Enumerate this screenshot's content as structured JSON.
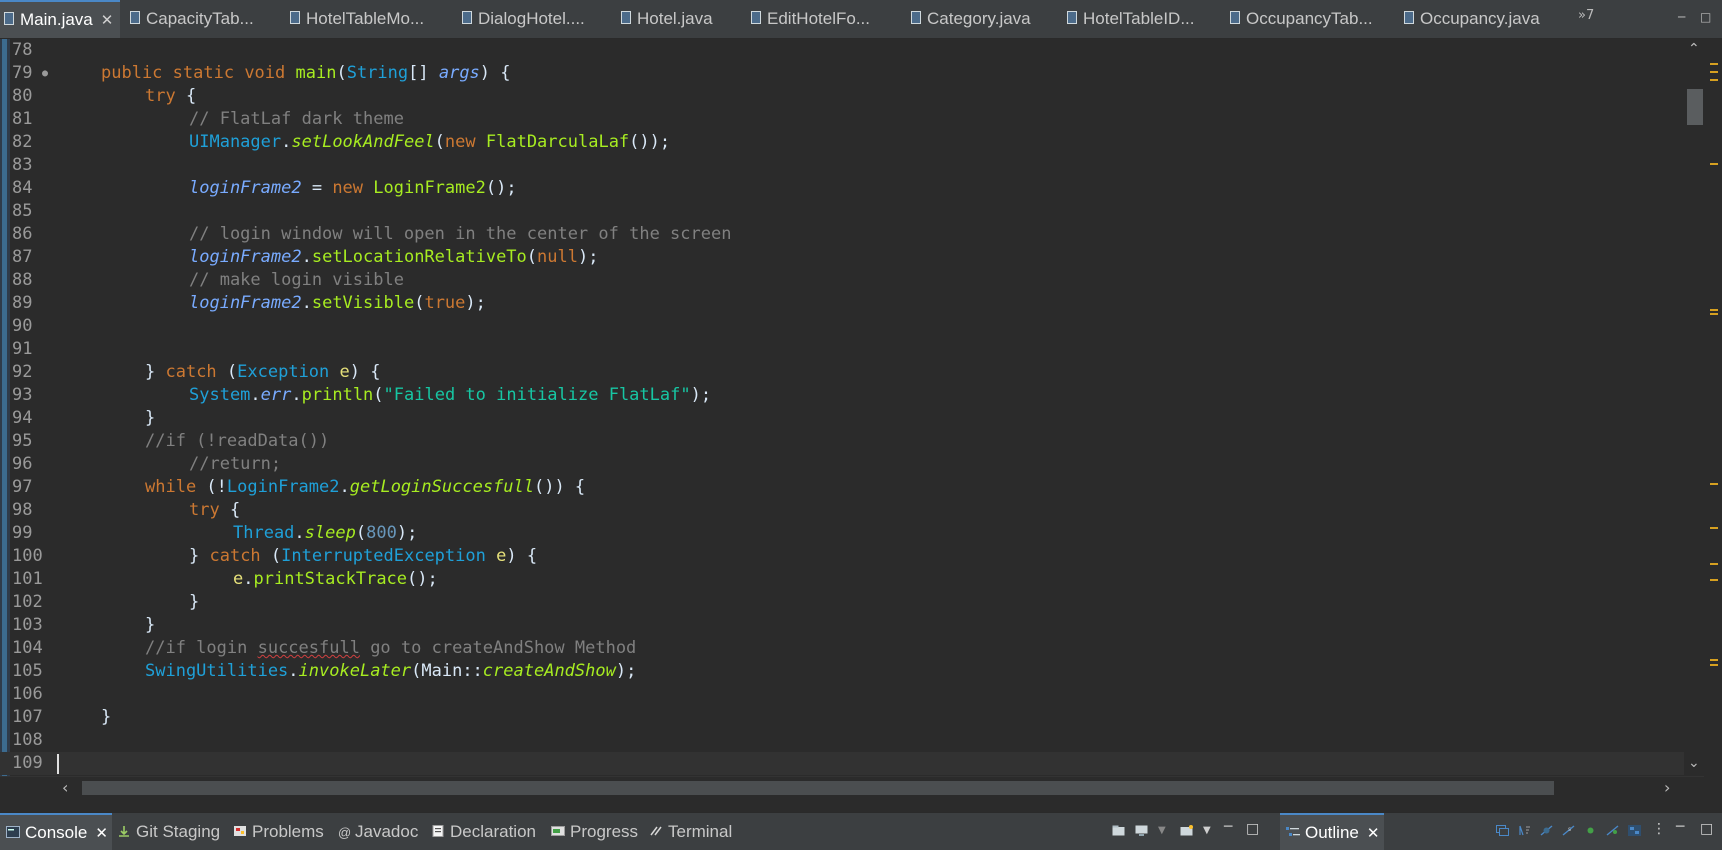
{
  "editor_tabs": [
    {
      "label": "Main.java",
      "active": true
    },
    {
      "label": "CapacityTab..."
    },
    {
      "label": "HotelTableMo..."
    },
    {
      "label": "DialogHotel...."
    },
    {
      "label": "Hotel.java"
    },
    {
      "label": "EditHotelFo..."
    },
    {
      "label": "Category.java"
    },
    {
      "label": "HotelTableID..."
    },
    {
      "label": "OccupancyTab..."
    },
    {
      "label": "Occupancy.java"
    }
  ],
  "overflow_count": "»7",
  "close_glyph": "✕",
  "code": {
    "line_numbers": [
      "78",
      "79",
      "80",
      "81",
      "82",
      "83",
      "84",
      "85",
      "86",
      "87",
      "88",
      "89",
      "90",
      "91",
      "92",
      "93",
      "94",
      "95",
      "96",
      "97",
      "98",
      "99",
      "100",
      "101",
      "102",
      "103",
      "104",
      "105",
      "106",
      "107",
      "108",
      "109"
    ],
    "lines": [
      [],
      [
        [
          "kw",
          "public "
        ],
        [
          "kw",
          "static "
        ],
        [
          "kw",
          "void "
        ],
        [
          "fn",
          "main"
        ],
        [
          "pl",
          "("
        ],
        [
          "ty",
          "String"
        ],
        [
          "pl",
          "[] "
        ],
        [
          "var",
          "args"
        ],
        [
          "pl",
          ") {"
        ]
      ],
      [
        [
          "kw",
          "try"
        ],
        [
          "pl",
          " {"
        ]
      ],
      [
        [
          "cm",
          "// FlatLaf dark theme"
        ]
      ],
      [
        [
          "ty",
          "UIManager"
        ],
        [
          "pl",
          "."
        ],
        [
          "fi",
          "setLookAndFeel"
        ],
        [
          "pl",
          "("
        ],
        [
          "kw",
          "new "
        ],
        [
          "fn",
          "FlatDarculaLaf"
        ],
        [
          "pl",
          "());"
        ]
      ],
      [],
      [
        [
          "var",
          "loginFrame2"
        ],
        [
          "pl",
          " = "
        ],
        [
          "kw",
          "new "
        ],
        [
          "fn",
          "LoginFrame2"
        ],
        [
          "pl",
          "();"
        ]
      ],
      [],
      [
        [
          "cm",
          "// login window will open in the center of the screen"
        ]
      ],
      [
        [
          "var",
          "loginFrame2"
        ],
        [
          "pl",
          "."
        ],
        [
          "fn",
          "setLocationRelativeTo"
        ],
        [
          "pl",
          "("
        ],
        [
          "kw",
          "null"
        ],
        [
          "pl",
          ");"
        ]
      ],
      [
        [
          "cm",
          "// make login visible"
        ]
      ],
      [
        [
          "var",
          "loginFrame2"
        ],
        [
          "pl",
          "."
        ],
        [
          "fn",
          "setVisible"
        ],
        [
          "pl",
          "("
        ],
        [
          "kw",
          "true"
        ],
        [
          "pl",
          ");"
        ]
      ],
      [],
      [],
      [
        [
          "pl",
          "} "
        ],
        [
          "kw",
          "catch "
        ],
        [
          "pl",
          "("
        ],
        [
          "ty",
          "Exception "
        ],
        [
          "par",
          "e"
        ],
        [
          "pl",
          ") {"
        ]
      ],
      [
        [
          "ty",
          "System"
        ],
        [
          "pl",
          "."
        ],
        [
          "var",
          "err"
        ],
        [
          "pl",
          "."
        ],
        [
          "fn",
          "println"
        ],
        [
          "pl",
          "("
        ],
        [
          "str",
          "\"Failed to initialize FlatLaf\""
        ],
        [
          "pl",
          ");"
        ]
      ],
      [
        [
          "pl",
          "}"
        ]
      ],
      [
        [
          "cm",
          "//if (!readData())"
        ]
      ],
      [
        [
          "cm",
          "//return;"
        ]
      ],
      [
        [
          "kw",
          "while "
        ],
        [
          "pl",
          "(!"
        ],
        [
          "ty",
          "LoginFrame2"
        ],
        [
          "pl",
          "."
        ],
        [
          "fi",
          "getLoginSuccesfull"
        ],
        [
          "pl",
          "()) {"
        ]
      ],
      [
        [
          "kw",
          "try"
        ],
        [
          "pl",
          " {"
        ]
      ],
      [
        [
          "ty",
          "Thread"
        ],
        [
          "pl",
          "."
        ],
        [
          "fi",
          "sleep"
        ],
        [
          "pl",
          "("
        ],
        [
          "num",
          "800"
        ],
        [
          "pl",
          ");"
        ]
      ],
      [
        [
          "pl",
          "} "
        ],
        [
          "kw",
          "catch "
        ],
        [
          "pl",
          "("
        ],
        [
          "ty",
          "InterruptedException "
        ],
        [
          "par",
          "e"
        ],
        [
          "pl",
          ") {"
        ]
      ],
      [
        [
          "par",
          "e"
        ],
        [
          "pl",
          "."
        ],
        [
          "fn",
          "printStackTrace"
        ],
        [
          "pl",
          "();"
        ]
      ],
      [
        [
          "pl",
          "}"
        ]
      ],
      [
        [
          "pl",
          "}"
        ]
      ],
      [
        [
          "cm",
          "//if login "
        ],
        [
          "cmsq",
          "succesfull"
        ],
        [
          "cm",
          " go to createAndShow Method"
        ]
      ],
      [
        [
          "ty",
          "SwingUtilities"
        ],
        [
          "pl",
          "."
        ],
        [
          "fi",
          "invokeLater"
        ],
        [
          "pl",
          "(Main::"
        ],
        [
          "fi",
          "createAndShow"
        ],
        [
          "pl",
          ");"
        ]
      ],
      [],
      [
        [
          "pl",
          "}"
        ]
      ],
      [],
      []
    ]
  },
  "bottom_tabs": [
    {
      "label": "Console",
      "active": true,
      "icon": "console-icon"
    },
    {
      "label": "Git Staging",
      "icon": "git-staging-icon"
    },
    {
      "label": "Problems",
      "icon": "problems-icon"
    },
    {
      "label": "Javadoc",
      "icon": "javadoc-icon"
    },
    {
      "label": "Declaration",
      "icon": "declaration-icon"
    },
    {
      "label": "Progress",
      "icon": "progress-icon"
    },
    {
      "label": "Terminal",
      "icon": "terminal-icon"
    }
  ],
  "outline_tab": {
    "label": "Outline",
    "icon": "outline-icon"
  },
  "colors": {
    "editor_bg": "#2b2b2b",
    "keyword": "#cc7832",
    "type": "#1fa0d8",
    "method": "#a7ec21",
    "comment": "#808080",
    "string": "#17c6a3",
    "number": "#6897bb",
    "accent": "#4a88c7"
  }
}
